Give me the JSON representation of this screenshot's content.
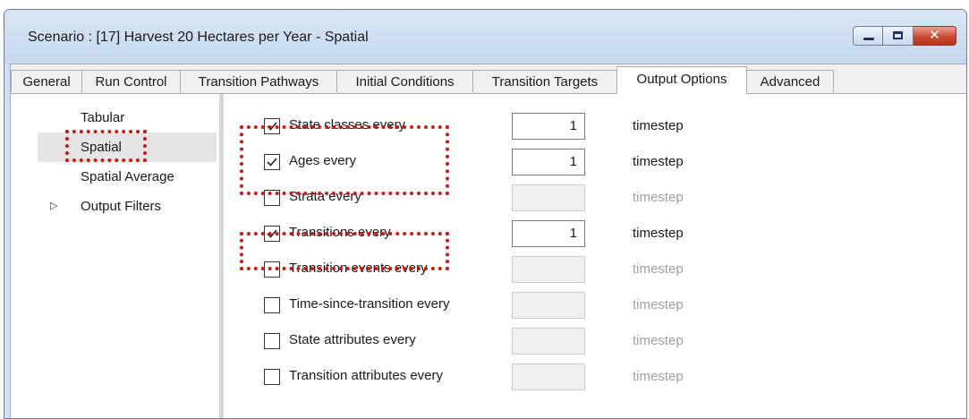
{
  "window": {
    "title": "Scenario : [17] Harvest 20 Hectares per Year - Spatial",
    "close_glyph": "✕"
  },
  "tabs": [
    {
      "label": "General"
    },
    {
      "label": "Run Control"
    },
    {
      "label": "Transition Pathways"
    },
    {
      "label": "Initial Conditions"
    },
    {
      "label": "Transition Targets"
    },
    {
      "label": "Output Options",
      "active": true
    },
    {
      "label": "Advanced"
    }
  ],
  "nav": {
    "items": [
      {
        "label": "Tabular"
      },
      {
        "label": "Spatial",
        "selected": true
      },
      {
        "label": "Spatial Average"
      },
      {
        "label": "Output Filters",
        "expander": "▷"
      }
    ]
  },
  "options": [
    {
      "label": "State classes every",
      "checked": true,
      "value": "1",
      "unit": "timestep"
    },
    {
      "label": "Ages every",
      "checked": true,
      "value": "1",
      "unit": "timestep"
    },
    {
      "label": "Strata every",
      "checked": false,
      "value": "",
      "unit": "timestep"
    },
    {
      "label": "Transitions every",
      "checked": true,
      "value": "1",
      "unit": "timestep"
    },
    {
      "label": "Transition events every",
      "checked": false,
      "value": "",
      "unit": "timestep"
    },
    {
      "label": "Time-since-transition every",
      "checked": false,
      "value": "",
      "unit": "timestep"
    },
    {
      "label": "State attributes every",
      "checked": false,
      "value": "",
      "unit": "timestep"
    },
    {
      "label": "Transition attributes every",
      "checked": false,
      "value": "",
      "unit": "timestep"
    }
  ],
  "colors": {
    "highlight": "#cc1a1a",
    "disabled_text": "#9f9f9f"
  }
}
